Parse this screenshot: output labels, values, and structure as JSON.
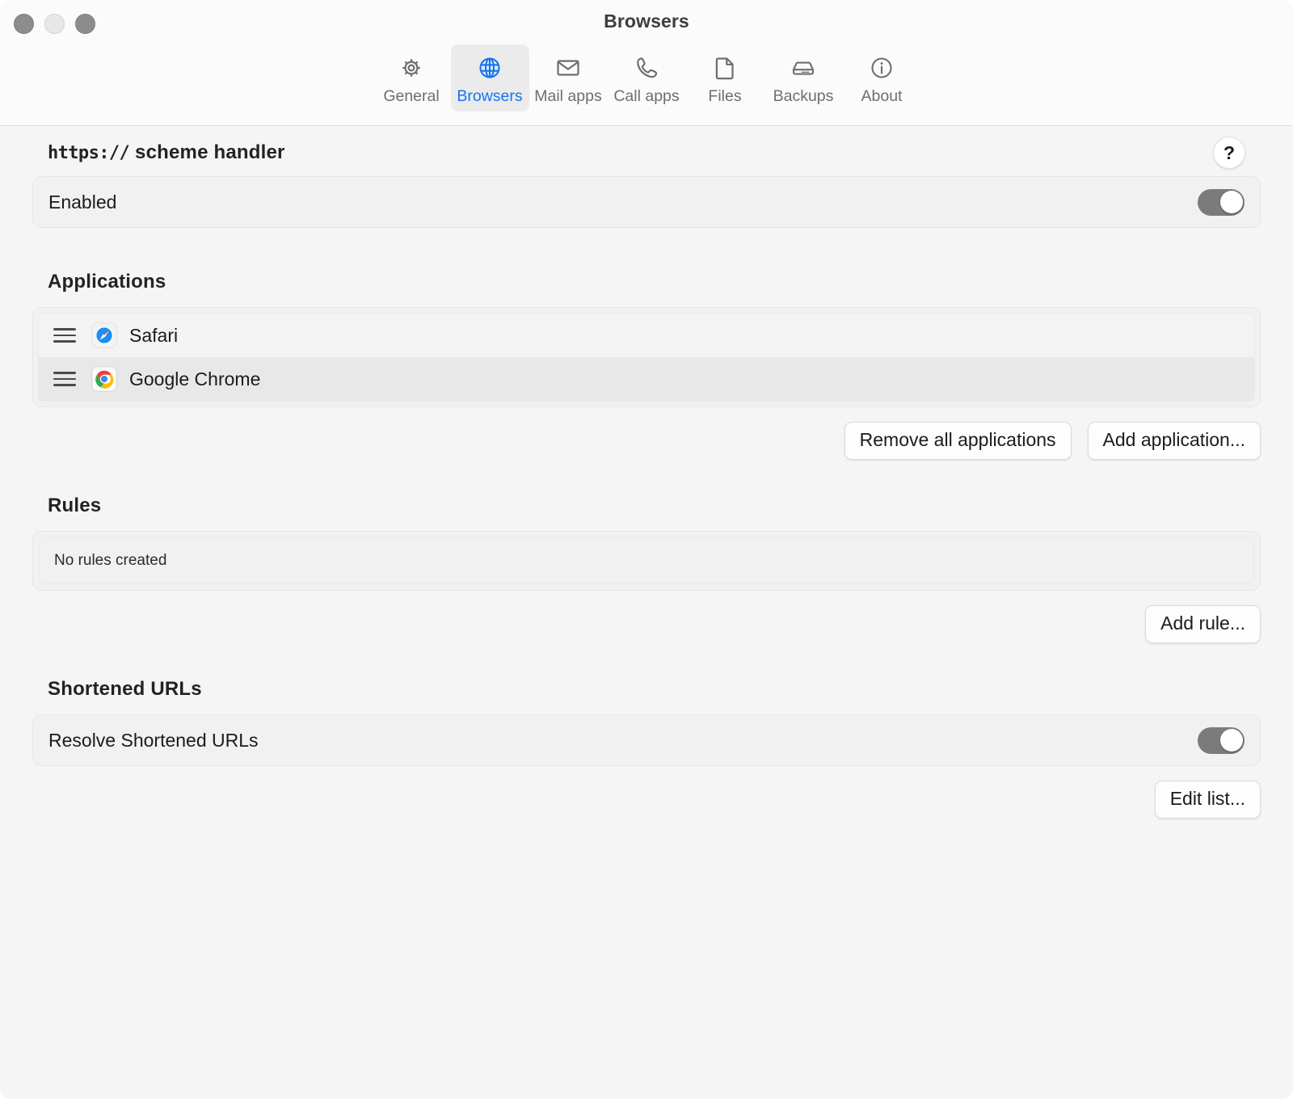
{
  "window": {
    "title": "Browsers",
    "traffic_lights": [
      "close",
      "minimize",
      "zoom"
    ]
  },
  "toolbar": {
    "items": [
      {
        "label": "General",
        "icon": "gear-icon",
        "selected": false
      },
      {
        "label": "Browsers",
        "icon": "globe-icon",
        "selected": true
      },
      {
        "label": "Mail apps",
        "icon": "envelope-icon",
        "selected": false
      },
      {
        "label": "Call apps",
        "icon": "phone-icon",
        "selected": false
      },
      {
        "label": "Files",
        "icon": "document-icon",
        "selected": false
      },
      {
        "label": "Backups",
        "icon": "harddisk-icon",
        "selected": false
      },
      {
        "label": "About",
        "icon": "info-icon",
        "selected": false
      }
    ],
    "accent_color": "#1474f5",
    "inactive_color": "#6e6e6e"
  },
  "scheme_handler": {
    "title_mono": "https://",
    "title_rest": " scheme handler",
    "help_label": "?",
    "enabled_label": "Enabled",
    "enabled_state": "on"
  },
  "applications": {
    "heading": "Applications",
    "items": [
      {
        "name": "Safari",
        "icon": "safari-icon"
      },
      {
        "name": "Google Chrome",
        "icon": "chrome-icon"
      }
    ],
    "remove_all_label": "Remove all applications",
    "add_label": "Add application..."
  },
  "rules": {
    "heading": "Rules",
    "empty_text": "No rules created",
    "add_label": "Add rule..."
  },
  "shortened_urls": {
    "heading": "Shortened URLs",
    "resolve_label": "Resolve Shortened URLs",
    "resolve_state": "on",
    "edit_label": "Edit list..."
  }
}
